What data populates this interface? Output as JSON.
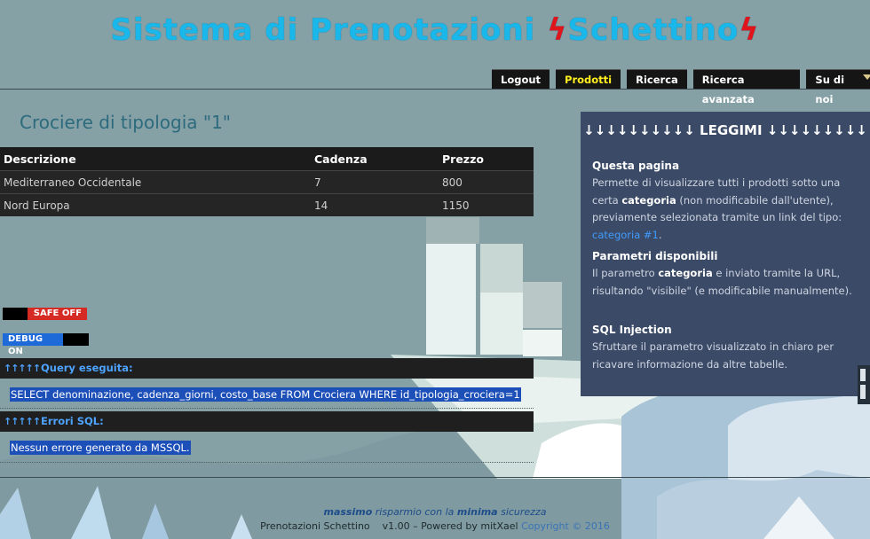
{
  "header": {
    "title_part1": "Sistema di Prenotazioni ",
    "title_part2": "Schettino",
    "bolt": "ϟ"
  },
  "nav": {
    "items": [
      {
        "label": "Logout",
        "active": false
      },
      {
        "label": "Prodotti",
        "active": true
      },
      {
        "label": "Ricerca",
        "active": false
      },
      {
        "label": "Ricerca avanzata",
        "active": false
      },
      {
        "label": "Su di noi",
        "active": false
      }
    ]
  },
  "main": {
    "heading": "Crociere di tipologia \"1\"",
    "table": {
      "headers": [
        "Descrizione",
        "Cadenza",
        "Prezzo"
      ],
      "rows": [
        [
          "Mediterraneo Occidentale",
          "7",
          "800"
        ],
        [
          "Nord Europa",
          "14",
          "1150"
        ]
      ]
    },
    "safe_toggle": "SAFE OFF",
    "debug_toggle": "DEBUG ON",
    "query": {
      "arrows": "↑↑↑↑↑",
      "title": "Query eseguita:",
      "text": "SELECT denominazione, cadenza_giorni, costo_base FROM Crociera WHERE id_tipologia_crociera=1"
    },
    "errors": {
      "arrows": "↑↑↑↑↑",
      "title": "Errori SQL:",
      "text": "Nessun errore generato da MSSQL."
    }
  },
  "sidebar": {
    "title": "↓↓↓↓↓↓↓↓↓↓ LEGGIMI ↓↓↓↓↓↓↓↓↓",
    "b1_title": "Questa pagina",
    "b1_t1": "Permette di visualizzare tutti i prodotti sotto una certa ",
    "b1_bold": "categoria",
    "b1_t2": " (non modificabile dall'utente), previamente selezionata tramite un link del tipo: ",
    "b1_link": "categoria #1",
    "b1_end": ".",
    "b2_title": "Parametri disponibili",
    "b2_t1": "Il parametro ",
    "b2_bold": "categoria",
    "b2_t2": " e inviato tramite la URL, risultando \"visibile\" (e modificabile manualmente).",
    "b3_title": "SQL Injection",
    "b3_text": "Sfruttare il parametro visualizzato in chiaro per ricavare informazione da altre tabelle."
  },
  "footer": {
    "s1": "massimo",
    "s2": " risparmio con la ",
    "s3": "minima",
    "s4": " sicurezza",
    "info": "Prenotazioni Schettino    v1.00 – Powered by mitXael",
    "copyright": "Copyright © 2016"
  },
  "colors": {
    "title": "#19b7ea",
    "bolt": "#e0141b",
    "active_nav": "#ffef1e",
    "safe_off": "#d62a24",
    "debug_on": "#1f6ad9",
    "sidebar_bg": "#3b4a66"
  }
}
